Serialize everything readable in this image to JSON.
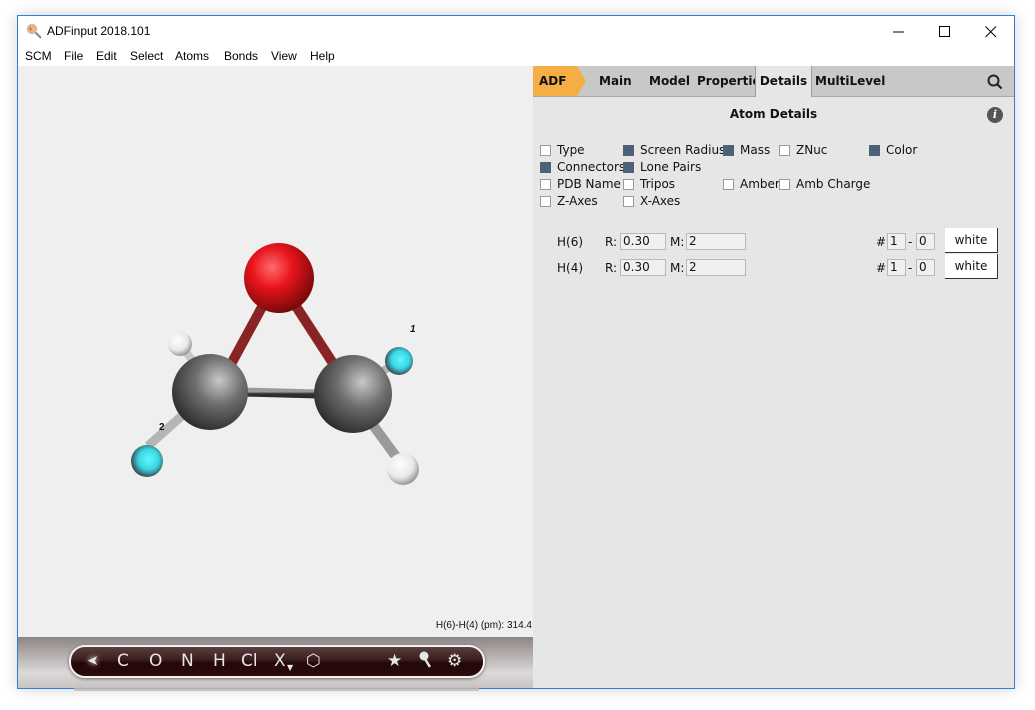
{
  "window": {
    "title": "ADFinput 2018.101",
    "controls": {
      "minimize": "—",
      "maximize": "☐",
      "close": "✕"
    }
  },
  "menubar": [
    "SCM",
    "File",
    "Edit",
    "Select",
    "Atoms",
    "Bonds",
    "View",
    "Help"
  ],
  "viewport": {
    "measurement": "H(6)-H(4) (pm): 314.4",
    "atom_labels": {
      "selected_1": "1",
      "selected_2": "2"
    }
  },
  "toolbar": {
    "tools": [
      {
        "name": "select-tool",
        "glyph": "➤"
      },
      {
        "name": "carbon",
        "glyph": "C"
      },
      {
        "name": "oxygen",
        "glyph": "O"
      },
      {
        "name": "nitrogen",
        "glyph": "N"
      },
      {
        "name": "hydrogen",
        "glyph": "H"
      },
      {
        "name": "chlorine",
        "glyph": "Cl"
      },
      {
        "name": "other-element",
        "glyph": "X"
      },
      {
        "name": "ring",
        "glyph": "⬡"
      },
      {
        "name": "favorites",
        "glyph": "★"
      },
      {
        "name": "tools",
        "glyph": "🔧"
      },
      {
        "name": "settings",
        "glyph": "⚙"
      }
    ]
  },
  "panel": {
    "tabs": [
      {
        "label": "ADF",
        "state": "engine"
      },
      {
        "label": "Main",
        "state": "normal"
      },
      {
        "label": "Model",
        "state": "normal"
      },
      {
        "label": "Properties",
        "state": "normal"
      },
      {
        "label": "Details",
        "state": "active"
      },
      {
        "label": "MultiLevel",
        "state": "normal"
      }
    ],
    "section_title": "Atom Details",
    "options": [
      {
        "label": "Type",
        "checked": false
      },
      {
        "label": "Screen Radius",
        "checked": true
      },
      {
        "label": "Mass",
        "checked": true
      },
      {
        "label": "ZNuc",
        "checked": false
      },
      {
        "label": "Color",
        "checked": true
      },
      {
        "label": "Connectors",
        "checked": true
      },
      {
        "label": "Lone Pairs",
        "checked": true
      },
      {
        "label": "PDB Name",
        "checked": false
      },
      {
        "label": "Tripos",
        "checked": false
      },
      {
        "label": "Amber",
        "checked": false
      },
      {
        "label": "Amb Charge",
        "checked": false
      },
      {
        "label": "Z-Axes",
        "checked": false
      },
      {
        "label": "X-Axes",
        "checked": false
      }
    ],
    "atoms": [
      {
        "name": "H(6)",
        "r_label": "R:",
        "r": "0.30",
        "m_label": "M:",
        "m": "2",
        "hash": "#",
        "n1": "1",
        "dash": "-",
        "n2": "0",
        "color": "white"
      },
      {
        "name": "H(4)",
        "r_label": "R:",
        "r": "0.30",
        "m_label": "M:",
        "m": "2",
        "hash": "#",
        "n1": "1",
        "dash": "-",
        "n2": "0",
        "color": "white"
      }
    ]
  },
  "colors": {
    "engine_tab": "#f5ae45",
    "checkbox_on": "#4d6278",
    "window_border": "#2b7fd6",
    "oxygen": "#ee1c24",
    "carbon": "#6e6e6e",
    "hydrogen": "#ffffff",
    "hydrogen_selected": "#3ee6f0"
  }
}
